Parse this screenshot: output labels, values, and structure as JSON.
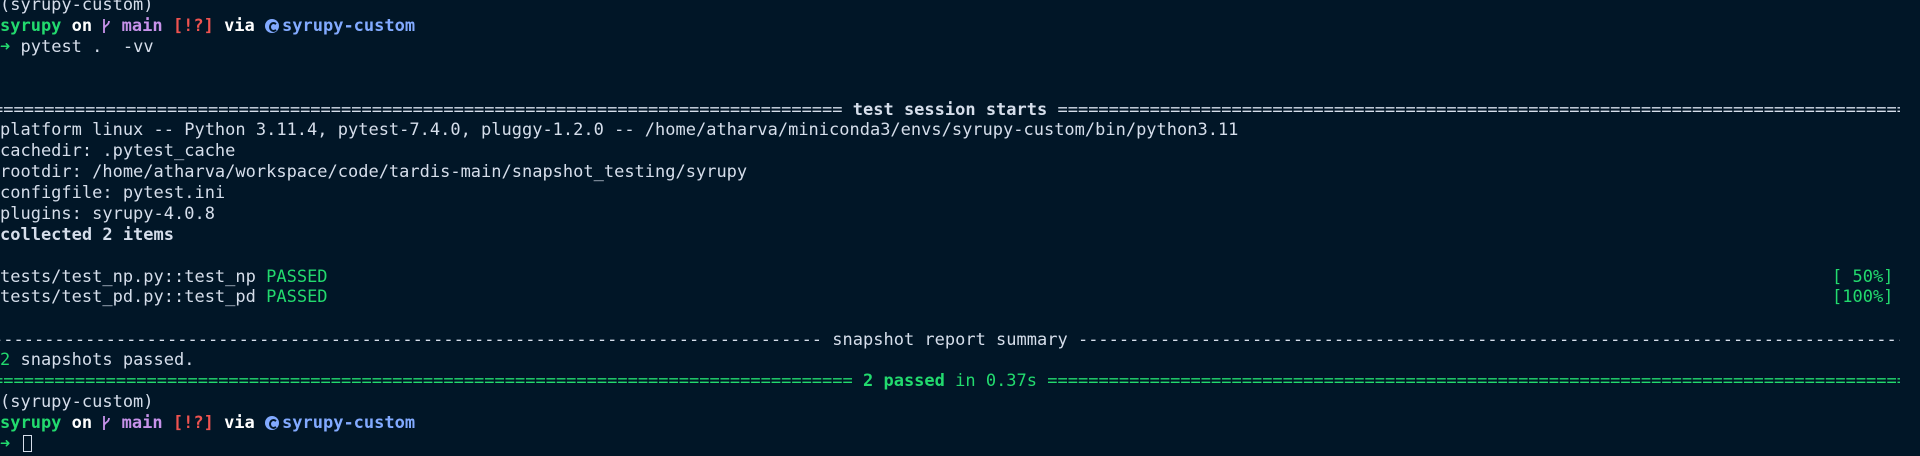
{
  "prompt_top": {
    "cut_line": "(syrupy-custom)",
    "dir": "syrupy",
    "on_word": "on",
    "branch": "main",
    "status": "[!?]",
    "via_word": "via",
    "env": "syrupy-custom",
    "arrow": "➜",
    "command": "pytest .  -vv"
  },
  "session": {
    "header": "test session starts",
    "platform": "platform linux -- Python 3.11.4, pytest-7.4.0, pluggy-1.2.0 -- /home/atharva/miniconda3/envs/syrupy-custom/bin/python3.11",
    "cachedir": "cachedir: .pytest_cache",
    "rootdir": "rootdir: /home/atharva/workspace/code/tardis-main/snapshot_testing/syrupy",
    "configfile": "configfile: pytest.ini",
    "plugins": "plugins: syrupy-4.0.8",
    "collected": "collected 2 items"
  },
  "tests": [
    {
      "name": "tests/test_np.py::test_np",
      "result": "PASSED",
      "progress": "[ 50%]"
    },
    {
      "name": "tests/test_pd.py::test_pd",
      "result": "PASSED",
      "progress": "[100%]"
    }
  ],
  "snapshot": {
    "header": "snapshot report summary",
    "count": "2",
    "text": " snapshots passed."
  },
  "summary": {
    "passed": "2 passed",
    "time": " in 0.37s"
  },
  "prompt_bottom": {
    "env_line": "(syrupy-custom)",
    "dir": "syrupy",
    "on_word": "on",
    "branch": "main",
    "status": "[!?]",
    "via_word": "via",
    "env": "syrupy-custom",
    "arrow": "➜"
  },
  "colors": {
    "background": "#011627",
    "green": "#22da6e",
    "purple": "#c792ea",
    "red": "#ef5350",
    "blue": "#82aaff"
  }
}
